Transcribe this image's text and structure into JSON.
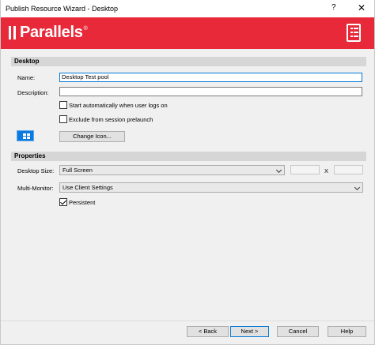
{
  "window": {
    "title": "Publish Resource Wizard - Desktop",
    "help_glyph": "?",
    "close_glyph": "✕"
  },
  "banner": {
    "logo_text": "Parallels",
    "logo_mark": "®",
    "brand_color": "#e8293a",
    "icon": "checklist-icon"
  },
  "desktop_section": {
    "header": "Desktop",
    "name_label": "Name:",
    "name_value": "Desktop Test pool",
    "description_label": "Description:",
    "description_value": "",
    "start_auto_label": "Start automatically when user logs on",
    "start_auto_checked": false,
    "exclude_prelaunch_label": "Exclude from session prelaunch",
    "exclude_prelaunch_checked": false,
    "icon_preview": "windows-logo-icon",
    "change_icon_label": "Change Icon..."
  },
  "properties_section": {
    "header": "Properties",
    "desktop_size_label": "Desktop Size:",
    "desktop_size_value": "Full Screen",
    "size_x_separator": "X",
    "width_value": "",
    "height_value": "",
    "multi_monitor_label": "Multi-Monitor:",
    "multi_monitor_value": "Use Client Settings",
    "persistent_label": "Persistent",
    "persistent_checked": true
  },
  "footer": {
    "back_label": "< Back",
    "next_label": "Next >",
    "cancel_label": "Cancel",
    "help_label": "Help"
  }
}
